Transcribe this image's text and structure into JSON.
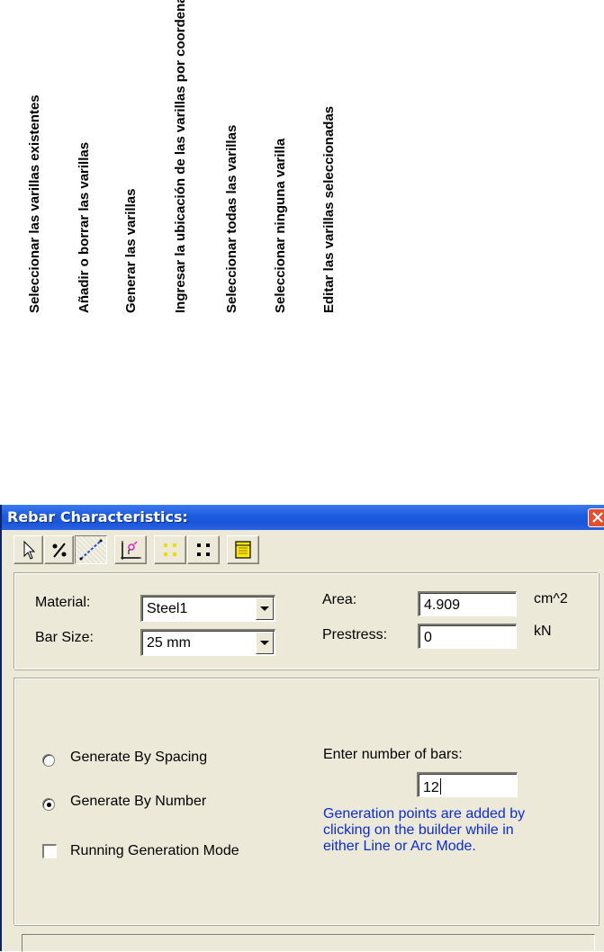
{
  "annotations": [
    "Seleccionar  las varillas existentes",
    "Añadir o borrar las varillas",
    "Generar las varillas",
    "Ingresar la ubicación de las varillas por coordenadas",
    "Seleccionar todas las varillas",
    "Seleccionar ninguna varilla",
    "Editar las varillas seleccionadas"
  ],
  "window": {
    "title": "Rebar Characteristics:",
    "colors": {
      "titlebar": "#1e5de0",
      "close": "#e4502e",
      "face": "#ece9d8",
      "hint_text": "#0a2bd8"
    }
  },
  "toolbar": {
    "buttons": [
      {
        "name": "select-arrow-icon",
        "state": "normal"
      },
      {
        "name": "add-delete-icon",
        "state": "normal"
      },
      {
        "name": "generate-line-icon",
        "state": "pressed"
      },
      {
        "name": "coordinate-input-icon",
        "state": "normal"
      },
      {
        "name": "select-all-icon",
        "state": "normal"
      },
      {
        "name": "select-none-icon",
        "state": "normal"
      },
      {
        "name": "edit-selected-icon",
        "state": "normal"
      }
    ]
  },
  "properties": {
    "material_label": "Material:",
    "material_value": "Steel1",
    "bar_size_label": "Bar Size:",
    "bar_size_value": "25 mm",
    "area_label": "Area:",
    "area_value": "4.909",
    "area_unit": "cm^2",
    "prestress_label": "Prestress:",
    "prestress_value": "0",
    "prestress_unit": "kN"
  },
  "generation": {
    "by_spacing_label": "Generate By Spacing",
    "by_number_label": "Generate By Number",
    "selected": "by_number",
    "running_mode_label": "Running Generation Mode",
    "running_mode_checked": false,
    "number_of_bars_label": "Enter number of bars:",
    "number_of_bars_value": "12",
    "hint_line1": "Generation points are added by",
    "hint_line2": "clicking on the builder while in",
    "hint_line3": "either Line or Arc Mode."
  },
  "status": {
    "text": ""
  }
}
